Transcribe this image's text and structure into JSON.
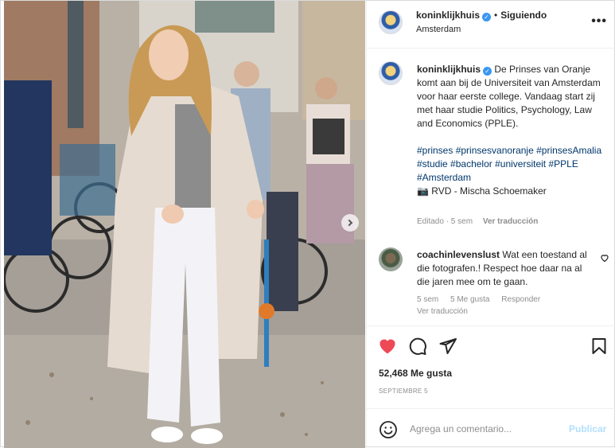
{
  "post": {
    "author": {
      "username": "koninklijkhuis",
      "verified": true,
      "follow_state": "Siguiendo",
      "location": "Amsterdam"
    },
    "more_label": "•••",
    "caption": {
      "text": "De Prinses van Oranje komt aan bij de Universiteit van Amsterdam voor haar eerste college. Vandaag start zij met haar studie Politics, Psychology, Law and Economics (PPLE).",
      "hashtags": [
        "#prinses",
        "#prinsesvanoranje",
        "#prinsesAmalia",
        "#studie",
        "#bachelor",
        "#universiteit",
        "#PPLE",
        "#Amsterdam"
      ],
      "credit": "📷 RVD - Mischa Schoemaker",
      "edited": "Editado · 5 sem",
      "translate": "Ver traducción"
    },
    "comment": {
      "username": "coachinlevenslust",
      "text": "Wat een toestand al die fotografen.! Respect hoe daar na al die jaren mee om te gaan.",
      "age": "5 sem",
      "likes": "5 Me gusta",
      "reply": "Responder",
      "translate": "Ver traducción"
    },
    "likes_count": "52,468 Me gusta",
    "date": "SEPTIEMBRE 5",
    "add_comment": {
      "placeholder": "Agrega un comentario...",
      "publish": "Publicar"
    },
    "icons": {
      "like": "heart-filled-icon",
      "comment": "speech-bubble-icon",
      "share": "paper-plane-icon",
      "save": "bookmark-icon",
      "emoji": "smiley-icon",
      "more": "ellipsis-icon",
      "carousel_next": "chevron-right-icon"
    },
    "colors": {
      "like_red": "#ed4956",
      "verified_blue": "#3897f0",
      "link_blue": "#00376b",
      "publish_disabled": "#b2dffc"
    }
  }
}
